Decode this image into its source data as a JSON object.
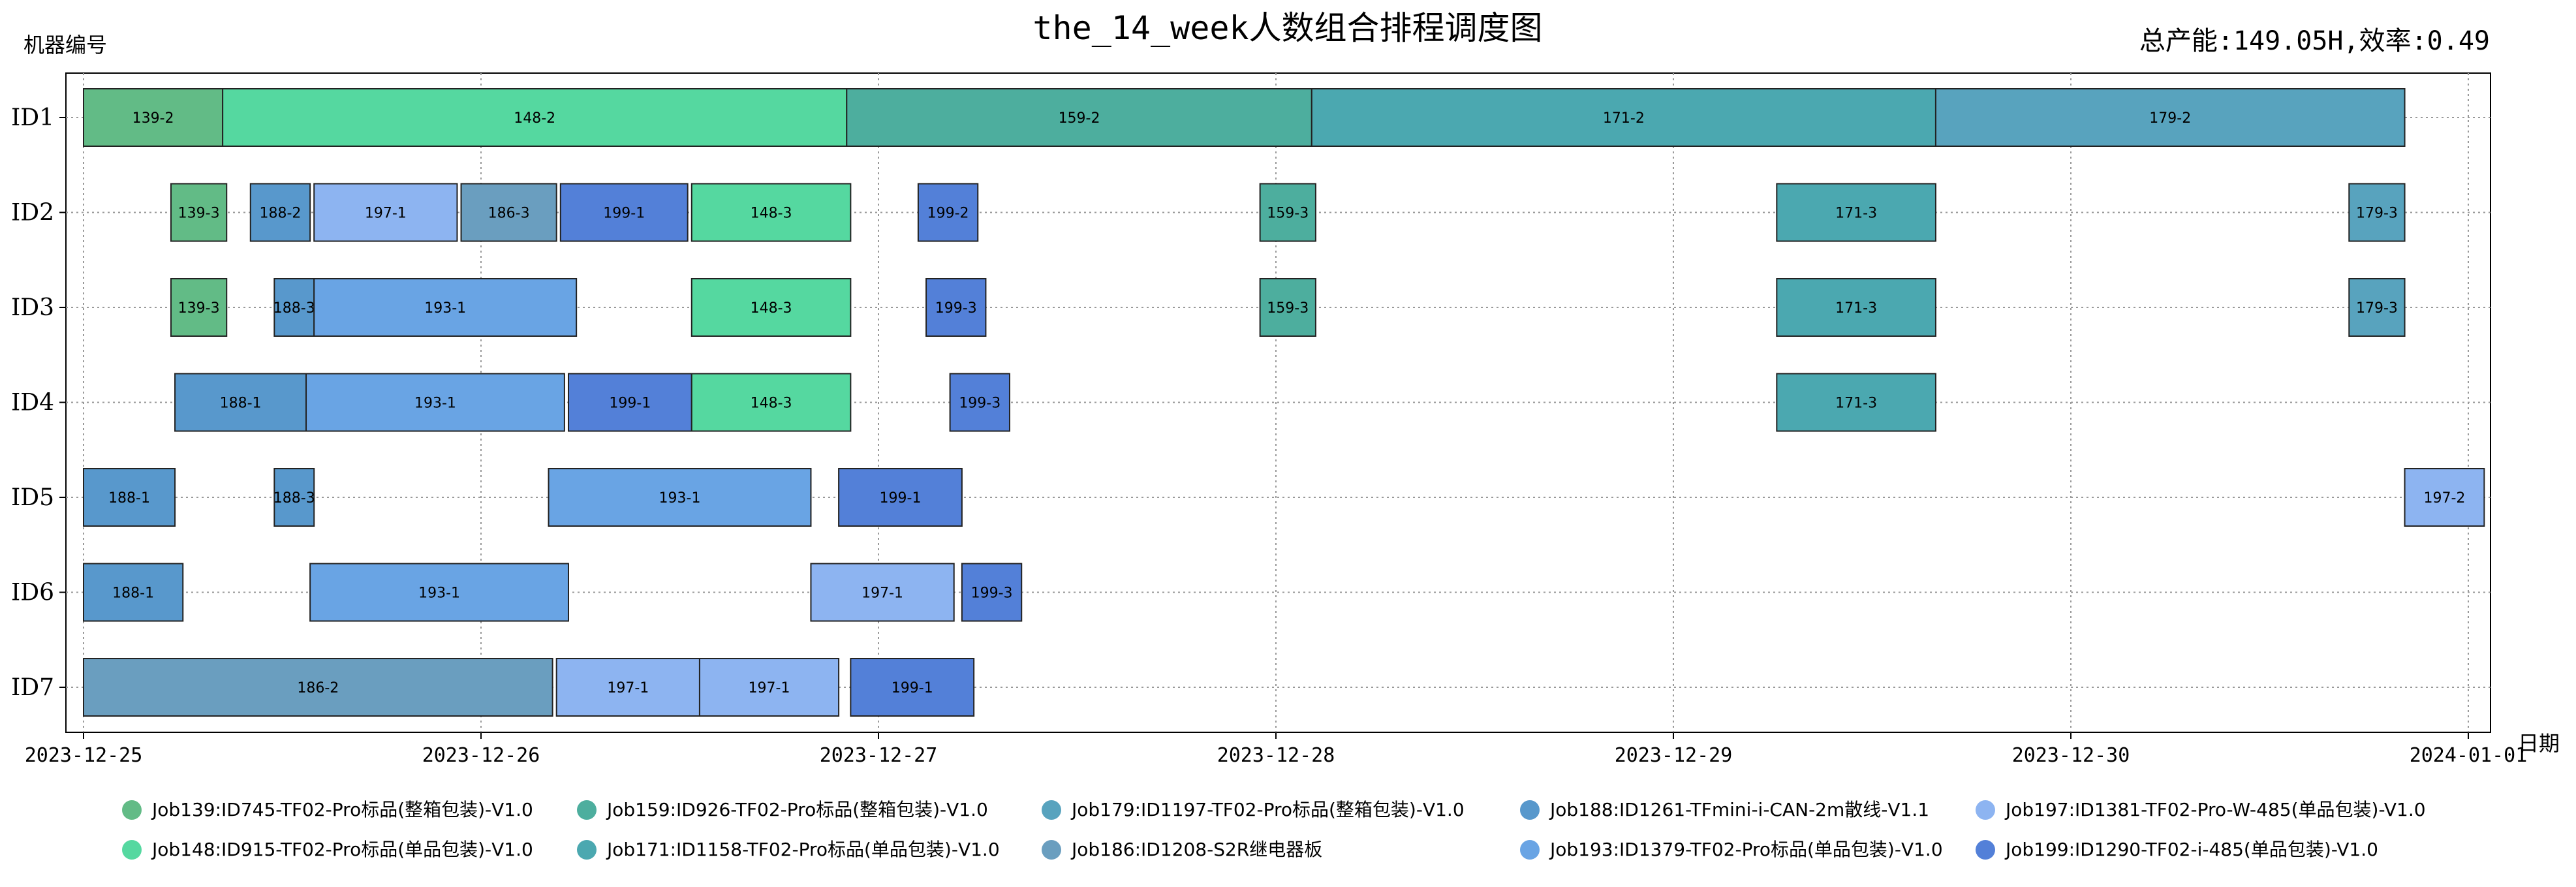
{
  "chart_data": {
    "type": "gantt",
    "title": "the_14_week人数组合排程调度图",
    "summary": "总产能:149.05H,效率:0.49",
    "ylabel": "机器编号",
    "xlabel": "日期",
    "grid": true,
    "legend_position": "bottom",
    "x_ticks": [
      "2023-12-25",
      "2023-12-26",
      "2023-12-27",
      "2023-12-28",
      "2023-12-29",
      "2023-12-30",
      "2024-01-01"
    ],
    "x_range_days": [
      -0.06,
      6.05
    ],
    "y_ticks": [
      "ID1",
      "ID2",
      "ID3",
      "ID4",
      "ID5",
      "ID6",
      "ID7"
    ],
    "legend": [
      {
        "job": "139",
        "label": "Job139:ID745-TF02-Pro标品(整箱包装)-V1.0",
        "color": "#62BB86"
      },
      {
        "job": "148",
        "label": "Job148:ID915-TF02-Pro标品(单品包装)-V1.0",
        "color": "#55D8A0"
      },
      {
        "job": "159",
        "label": "Job159:ID926-TF02-Pro标品(整箱包装)-V1.0",
        "color": "#4DAE9E"
      },
      {
        "job": "171",
        "label": "Job171:ID1158-TF02-Pro标品(单品包装)-V1.0",
        "color": "#4BA8B0"
      },
      {
        "job": "179",
        "label": "Job179:ID1197-TF02-Pro标品(整箱包装)-V1.0",
        "color": "#58A3BE"
      },
      {
        "job": "186",
        "label": "Job186:ID1208-S2R继电器板",
        "color": "#6A9EBF"
      },
      {
        "job": "188",
        "label": "Job188:ID1261-TFmini-i-CAN-2m散线-V1.1",
        "color": "#5898CC"
      },
      {
        "job": "193",
        "label": "Job193:ID1379-TF02-Pro标品(单品包装)-V1.0",
        "color": "#69A4E4"
      },
      {
        "job": "197",
        "label": "Job197:ID1381-TF02-Pro-W-485(单品包装)-V1.0",
        "color": "#8DB4F1"
      },
      {
        "job": "199",
        "label": "Job199:ID1290-TF02-i-485(单品包装)-V1.0",
        "color": "#5380D8"
      }
    ],
    "tasks": [
      {
        "machine": "ID1",
        "job": "139",
        "label": "139-2",
        "start": 0.0,
        "end": 0.35
      },
      {
        "machine": "ID1",
        "job": "148",
        "label": "148-2",
        "start": 0.35,
        "end": 1.92
      },
      {
        "machine": "ID1",
        "job": "159",
        "label": "159-2",
        "start": 1.92,
        "end": 3.09
      },
      {
        "machine": "ID1",
        "job": "171",
        "label": "171-2",
        "start": 3.09,
        "end": 4.66
      },
      {
        "machine": "ID1",
        "job": "179",
        "label": "179-2",
        "start": 4.66,
        "end": 5.84
      },
      {
        "machine": "ID2",
        "job": "139",
        "label": "139-3",
        "start": 0.22,
        "end": 0.36
      },
      {
        "machine": "ID2",
        "job": "188",
        "label": "188-2",
        "start": 0.42,
        "end": 0.57
      },
      {
        "machine": "ID2",
        "job": "197",
        "label": "197-1",
        "start": 0.58,
        "end": 0.94
      },
      {
        "machine": "ID2",
        "job": "186",
        "label": "186-3",
        "start": 0.95,
        "end": 1.19
      },
      {
        "machine": "ID2",
        "job": "199",
        "label": "199-1",
        "start": 1.2,
        "end": 1.52
      },
      {
        "machine": "ID2",
        "job": "148",
        "label": "148-3",
        "start": 1.53,
        "end": 1.93
      },
      {
        "machine": "ID2",
        "job": "199",
        "label": "199-2",
        "start": 2.1,
        "end": 2.25
      },
      {
        "machine": "ID2",
        "job": "159",
        "label": "159-3",
        "start": 2.96,
        "end": 3.1
      },
      {
        "machine": "ID2",
        "job": "171",
        "label": "171-3",
        "start": 4.26,
        "end": 4.66
      },
      {
        "machine": "ID2",
        "job": "179",
        "label": "179-3",
        "start": 5.7,
        "end": 5.84
      },
      {
        "machine": "ID3",
        "job": "139",
        "label": "139-3",
        "start": 0.22,
        "end": 0.36
      },
      {
        "machine": "ID3",
        "job": "188",
        "label": "188-3",
        "start": 0.48,
        "end": 0.58
      },
      {
        "machine": "ID3",
        "job": "193",
        "label": "193-1",
        "start": 0.58,
        "end": 1.24
      },
      {
        "machine": "ID3",
        "job": "148",
        "label": "148-3",
        "start": 1.53,
        "end": 1.93
      },
      {
        "machine": "ID3",
        "job": "199",
        "label": "199-3",
        "start": 2.12,
        "end": 2.27
      },
      {
        "machine": "ID3",
        "job": "159",
        "label": "159-3",
        "start": 2.96,
        "end": 3.1
      },
      {
        "machine": "ID3",
        "job": "171",
        "label": "171-3",
        "start": 4.26,
        "end": 4.66
      },
      {
        "machine": "ID3",
        "job": "179",
        "label": "179-3",
        "start": 5.7,
        "end": 5.84
      },
      {
        "machine": "ID4",
        "job": "188",
        "label": "188-1",
        "start": 0.23,
        "end": 0.56
      },
      {
        "machine": "ID4",
        "job": "193",
        "label": "193-1",
        "start": 0.56,
        "end": 1.21
      },
      {
        "machine": "ID4",
        "job": "199",
        "label": "199-1",
        "start": 1.22,
        "end": 1.53
      },
      {
        "machine": "ID4",
        "job": "148",
        "label": "148-3",
        "start": 1.53,
        "end": 1.93
      },
      {
        "machine": "ID4",
        "job": "199",
        "label": "199-3",
        "start": 2.18,
        "end": 2.33
      },
      {
        "machine": "ID4",
        "job": "171",
        "label": "171-3",
        "start": 4.26,
        "end": 4.66
      },
      {
        "machine": "ID5",
        "job": "188",
        "label": "188-1",
        "start": 0.0,
        "end": 0.23
      },
      {
        "machine": "ID5",
        "job": "188",
        "label": "188-3",
        "start": 0.48,
        "end": 0.58
      },
      {
        "machine": "ID5",
        "job": "193",
        "label": "193-1",
        "start": 1.17,
        "end": 1.83
      },
      {
        "machine": "ID5",
        "job": "199",
        "label": "199-1",
        "start": 1.9,
        "end": 2.21
      },
      {
        "machine": "ID5",
        "job": "197",
        "label": "197-2",
        "start": 5.84,
        "end": 6.04
      },
      {
        "machine": "ID6",
        "job": "188",
        "label": "188-1",
        "start": 0.0,
        "end": 0.25
      },
      {
        "machine": "ID6",
        "job": "193",
        "label": "193-1",
        "start": 0.57,
        "end": 1.22
      },
      {
        "machine": "ID6",
        "job": "197",
        "label": "197-1",
        "start": 1.83,
        "end": 2.19
      },
      {
        "machine": "ID6",
        "job": "199",
        "label": "199-3",
        "start": 2.21,
        "end": 2.36
      },
      {
        "machine": "ID7",
        "job": "186",
        "label": "186-2",
        "start": 0.0,
        "end": 1.18
      },
      {
        "machine": "ID7",
        "job": "197",
        "label": "197-1",
        "start": 1.19,
        "end": 1.55
      },
      {
        "machine": "ID7",
        "job": "197",
        "label": "197-1",
        "start": 1.55,
        "end": 1.9
      },
      {
        "machine": "ID7",
        "job": "199",
        "label": "199-1",
        "start": 1.93,
        "end": 2.24
      }
    ]
  }
}
